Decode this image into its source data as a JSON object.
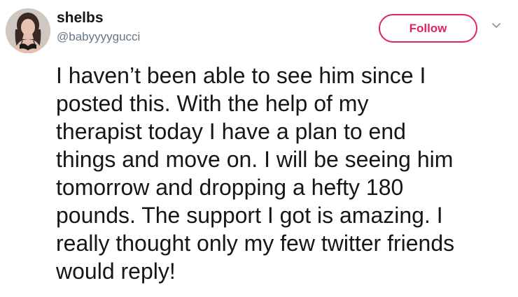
{
  "tweet": {
    "author": {
      "display_name": "shelbs",
      "handle": "@babyyyygucci"
    },
    "follow_label": "Follow",
    "text": "I haven’t been able to see him since I\nposted this. With the help of my\ntherapist today I have a plan to end\nthings and move on. I will be seeing him\ntomorrow and dropping a hefty 180\npounds. The support I got is amazing. I\nreally thought only my few twitter friends\nwould reply!"
  },
  "icons": {
    "avatar": "user-avatar",
    "more": "chevron-down-icon"
  },
  "colors": {
    "follow_accent": "#e0245e",
    "handle_gray": "#657786",
    "text": "#14171a",
    "chevron": "#8899a6"
  }
}
